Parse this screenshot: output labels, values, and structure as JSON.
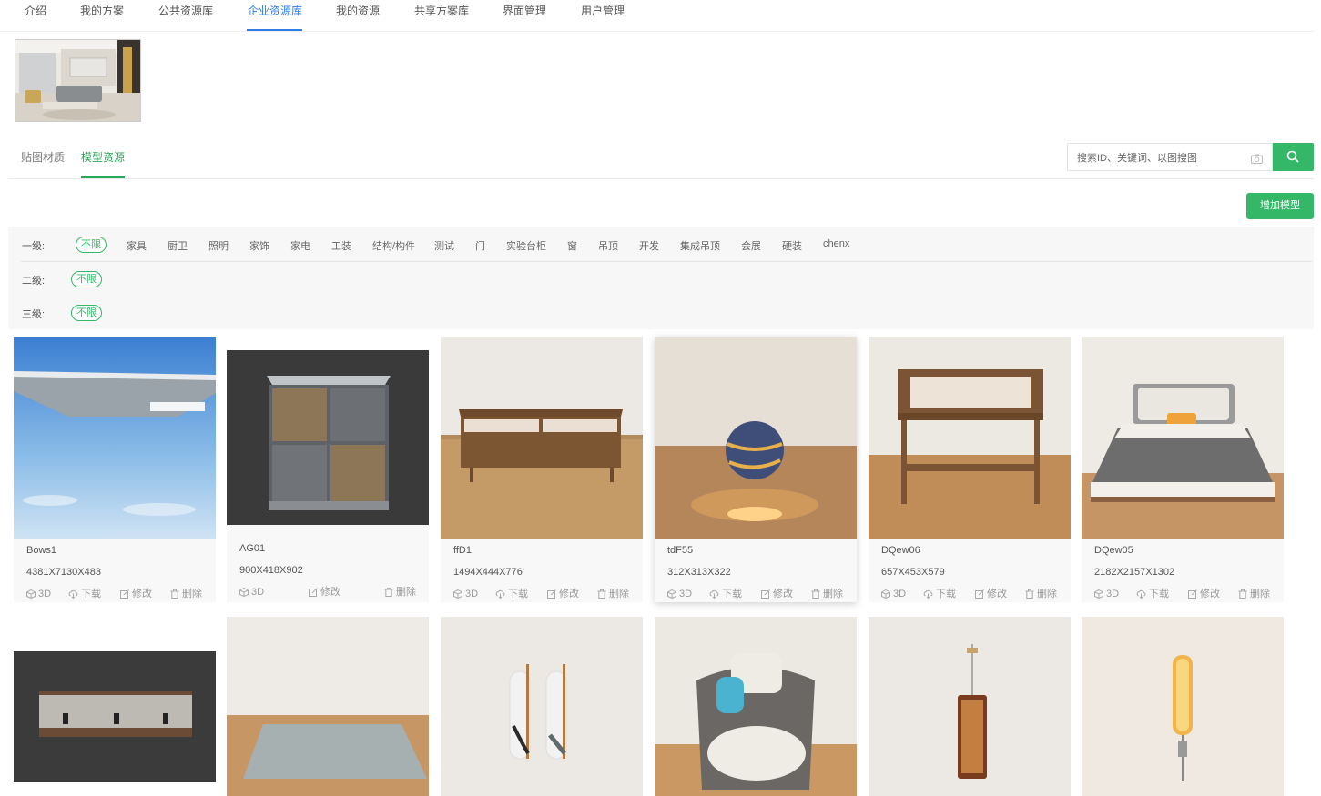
{
  "nav": {
    "items": [
      "介绍",
      "我的方案",
      "公共资源库",
      "企业资源库",
      "我的资源",
      "共享方案库",
      "界面管理",
      "用户管理"
    ],
    "active": "企业资源库"
  },
  "subtabs": {
    "items": [
      "贴图材质",
      "模型资源"
    ],
    "active": "模型资源"
  },
  "search": {
    "placeholder": "搜索ID、关键词、以图搜图",
    "icon": "search-icon",
    "camera_icon": "camera-icon"
  },
  "add_button": "增加模型",
  "filters": {
    "level1_label": "一级:",
    "level2_label": "二级:",
    "level3_label": "三级:",
    "all_chip": "不限",
    "level1_categories": [
      "家具",
      "厨卫",
      "照明",
      "家饰",
      "家电",
      "工装",
      "结构/构件",
      "测试",
      "门",
      "实验台柜",
      "窗",
      "吊顶",
      "开发",
      "集成吊顶",
      "会展",
      "硬装",
      "chenx"
    ]
  },
  "action_labels": {
    "view3d": "3D",
    "download": "下载",
    "edit": "修改",
    "delete": "删除"
  },
  "models_row1": [
    {
      "name": "Bows1",
      "size": "4381X7130X483"
    },
    {
      "name": "AG01",
      "size": "900X418X902"
    },
    {
      "name": "ffD1",
      "size": "1494X444X776"
    },
    {
      "name": "tdF55",
      "size": "312X313X322"
    },
    {
      "name": "DQew06",
      "size": "657X453X579"
    },
    {
      "name": "DQew05",
      "size": "2182X2157X1302"
    }
  ],
  "colors": {
    "nav_active": "#2f7ee8",
    "accent_green": "#34b868",
    "filter_bg": "#f7f7f7"
  }
}
